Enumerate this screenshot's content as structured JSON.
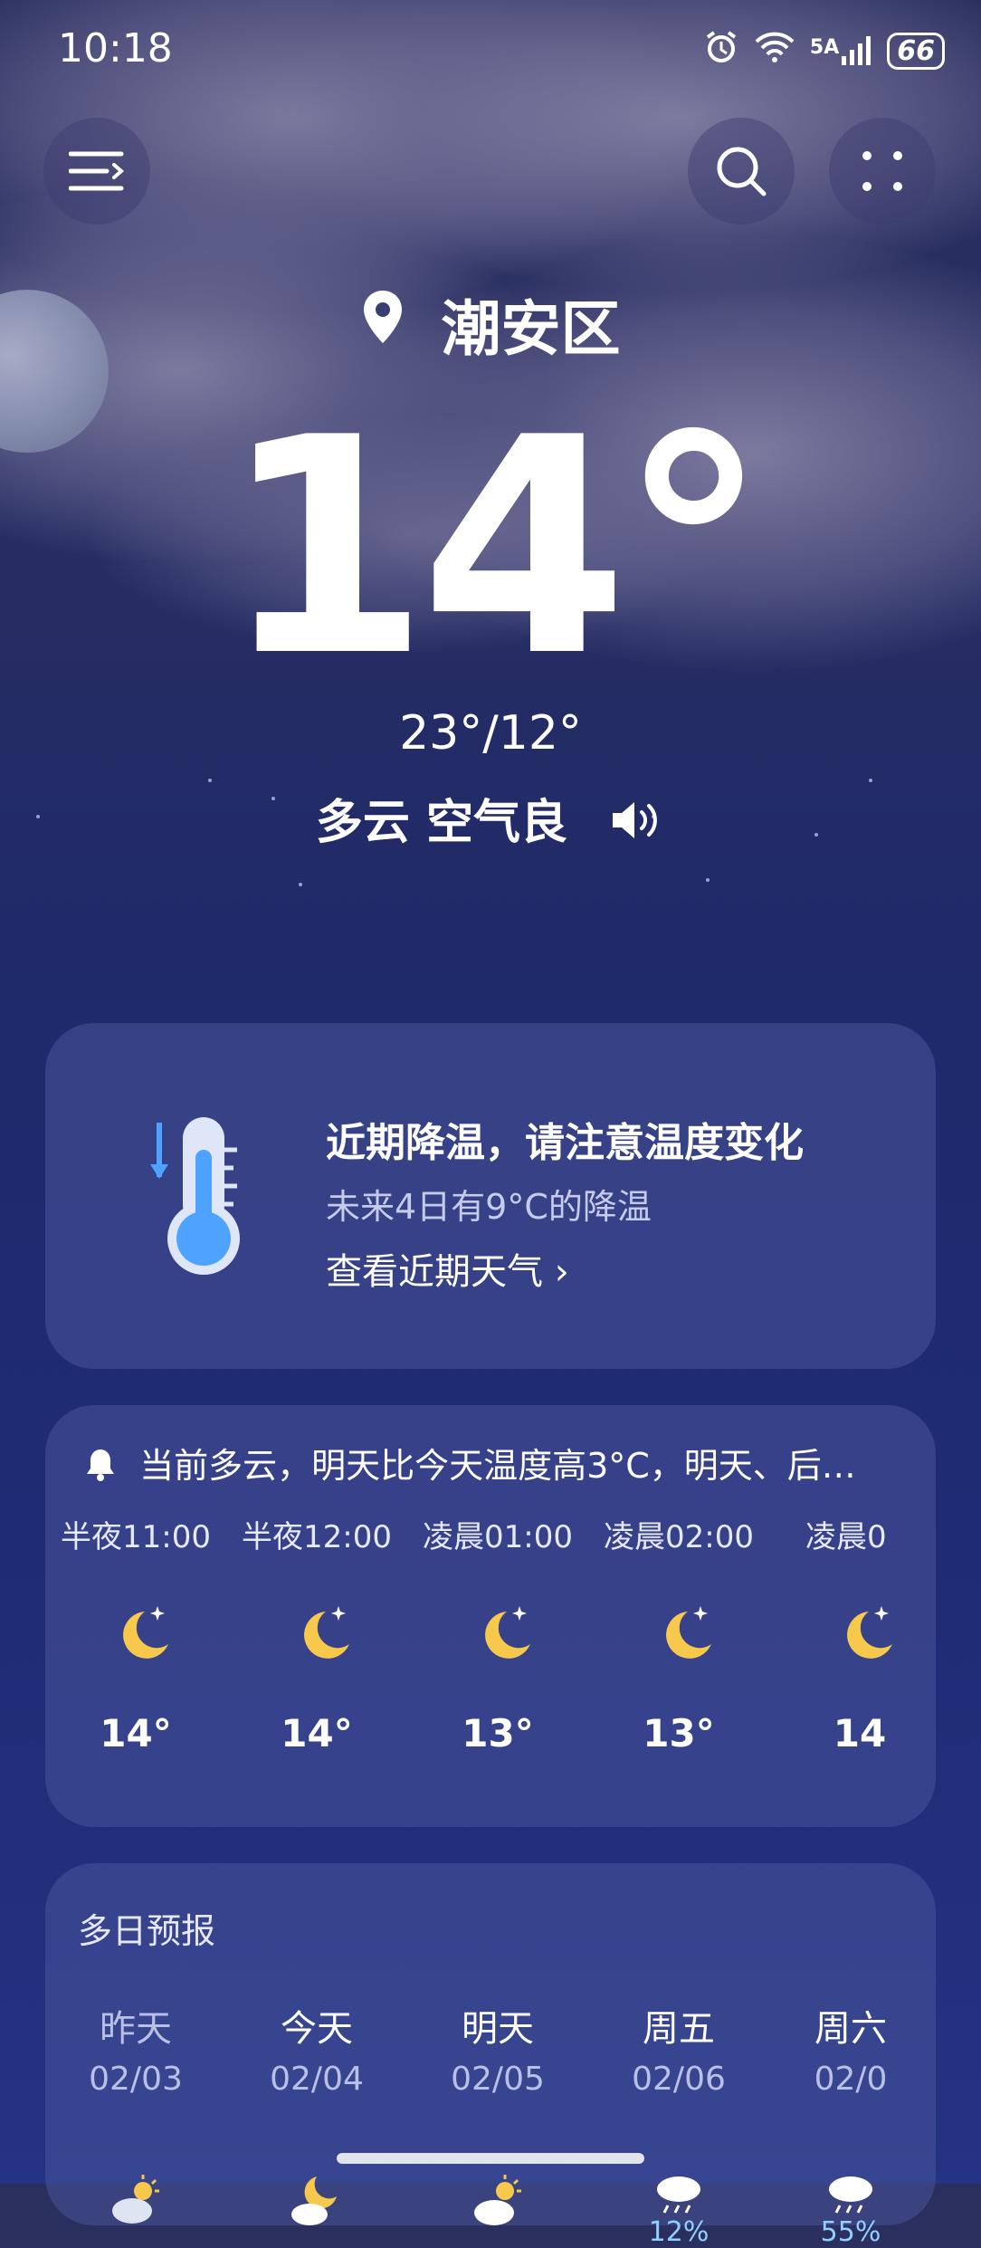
{
  "status": {
    "time": "10:18",
    "network": "5A",
    "battery": "66"
  },
  "location": "潮安区",
  "current": {
    "temp": "14°",
    "hilo": "23°/12°",
    "condition": "多云 空气良"
  },
  "alert": {
    "title": "近期降温，请注意温度变化",
    "subtitle": "未来4日有9°C的降温",
    "link": "查看近期天气 ›"
  },
  "hourly": {
    "message": "当前多云，明天比今天温度高3°C，明天、后…",
    "items": [
      {
        "time": "半夜11:00",
        "temp": "14°",
        "icon": "moon-star-icon"
      },
      {
        "time": "半夜12:00",
        "temp": "14°",
        "icon": "moon-star-icon"
      },
      {
        "time": "凌晨01:00",
        "temp": "13°",
        "icon": "moon-star-icon"
      },
      {
        "time": "凌晨02:00",
        "temp": "13°",
        "icon": "moon-star-icon"
      },
      {
        "time": "凌晨0",
        "temp": "14",
        "icon": "moon-star-icon"
      }
    ]
  },
  "daily": {
    "title": "多日预报",
    "items": [
      {
        "name": "昨天",
        "date": "02/03",
        "icon": "sun-cloud-icon",
        "pct": ""
      },
      {
        "name": "今天",
        "date": "02/04",
        "icon": "moon-cloud-icon",
        "pct": ""
      },
      {
        "name": "明天",
        "date": "02/05",
        "icon": "sun-cloud-icon",
        "pct": ""
      },
      {
        "name": "周五",
        "date": "02/06",
        "icon": "rain-cloud-icon",
        "pct": "12%"
      },
      {
        "name": "周六",
        "date": "02/0",
        "icon": "rain-cloud-icon",
        "pct": "55%"
      }
    ]
  },
  "colors": {
    "moon": "#f6c84c",
    "accent_blue": "#4da3ff"
  }
}
